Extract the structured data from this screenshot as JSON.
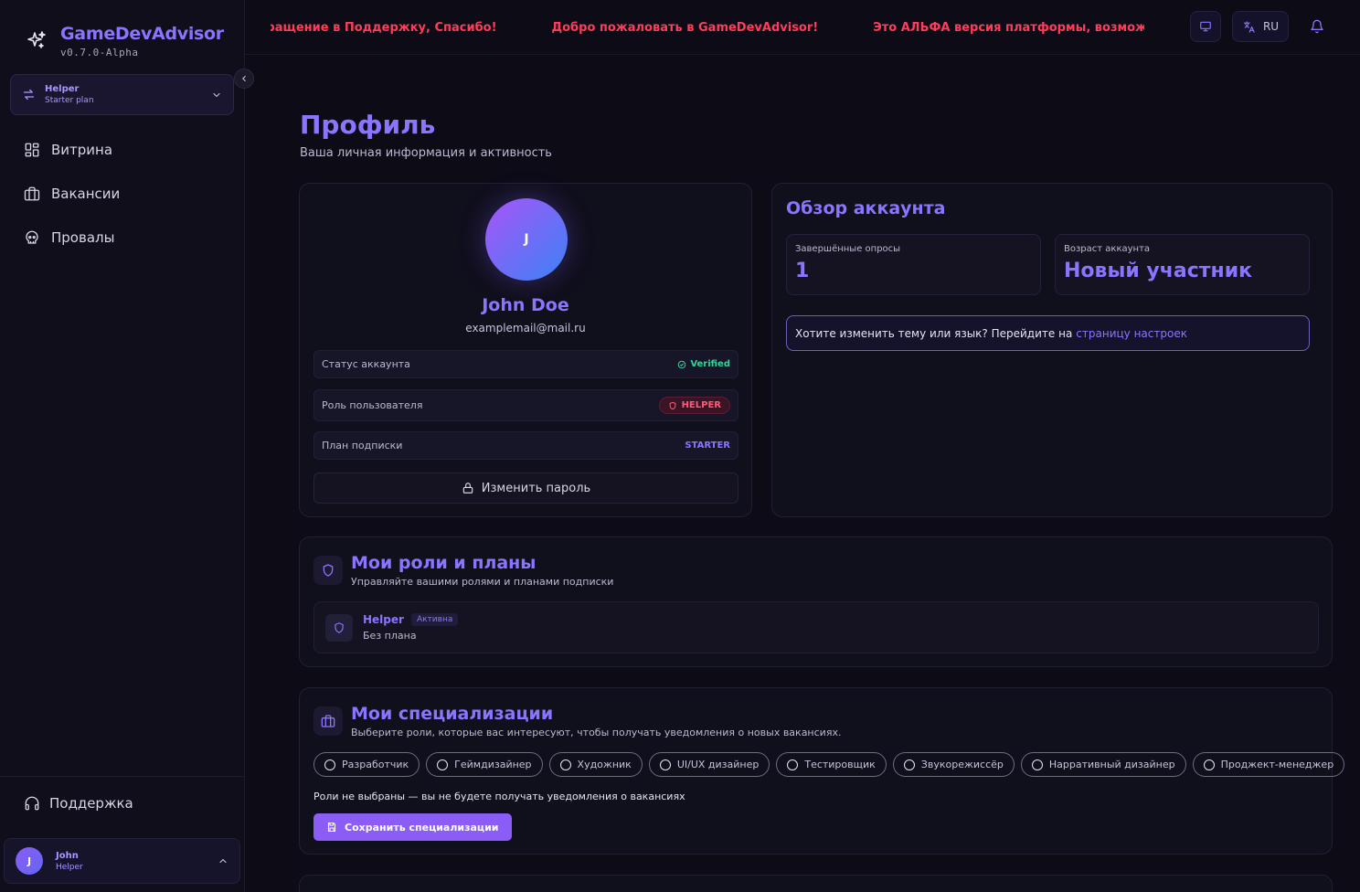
{
  "sidebar": {
    "brand_title": "GameDevAdvisor",
    "brand_version": "v0.7.0-Alpha",
    "plan_switch": {
      "role": "Helper",
      "plan": "Starter plan"
    },
    "items": [
      {
        "label": "Витрина",
        "icon": "grid-icon"
      },
      {
        "label": "Вакансии",
        "icon": "briefcase-icon"
      },
      {
        "label": "Провалы",
        "icon": "skull-icon"
      }
    ],
    "support_label": "Поддержка",
    "user": {
      "initial": "J",
      "name": "John",
      "role": "Helper"
    }
  },
  "topbar": {
    "ticker": [
      ", через обращение в Поддержку, Спасибо!",
      "Добро пожаловать в GameDevAdvisor!",
      "Это АЛЬФА версия платформы, возможны"
    ],
    "lang": "RU"
  },
  "page": {
    "title": "Профиль",
    "subtitle": "Ваша личная информация и активность"
  },
  "profile": {
    "initial": "J",
    "name": "John Doe",
    "email": "examplemail@mail.ru",
    "rows": [
      {
        "label": "Статус аккаунта",
        "value": "Verified"
      },
      {
        "label": "Роль пользователя",
        "value": "HELPER"
      },
      {
        "label": "План подписки",
        "value": "STARTER"
      }
    ],
    "change_password": "Изменить пароль"
  },
  "overview": {
    "title": "Обзор аккаунта",
    "stats": [
      {
        "label": "Завершённые опросы",
        "value": "1"
      },
      {
        "label": "Возраст аккаунта",
        "value": "Новый участник"
      }
    ],
    "hint_text": "Хотите изменить тему или язык? Перейдите на",
    "hint_link": "страницу настроек"
  },
  "roles": {
    "title": "Мои роли и планы",
    "subtitle": "Управляйте вашими ролями и планами подписки",
    "items": [
      {
        "name": "Helper",
        "status": "Активна",
        "plan": "Без плана"
      }
    ]
  },
  "specializations": {
    "title": "Мои специализации",
    "subtitle": "Выберите роли, которые вас интересуют, чтобы получать уведомления о новых вакансиях.",
    "options": [
      "Разработчик",
      "Геймдизайнер",
      "Художник",
      "UI/UX дизайнер",
      "Тестировщик",
      "Звукорежиссёр",
      "Нарративный дизайнер",
      "Проджект-менеджер"
    ],
    "empty_note": "Роли не выбраны — вы не будете получать уведомления о вакансиях",
    "save_label": "Сохранить специализации"
  },
  "colors": {
    "accent": "#8b74ff",
    "ticker": "#ff3d5a",
    "verified": "#34d399",
    "helper_badge": "#ff5b78",
    "background": "#0c0b16"
  }
}
